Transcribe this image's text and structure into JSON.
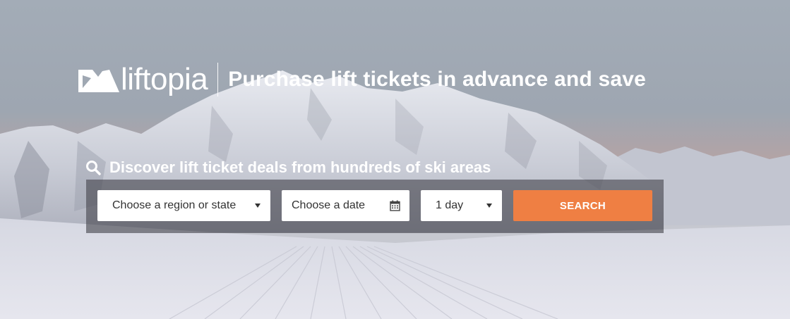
{
  "brand": {
    "logo_text": "liftopia"
  },
  "header": {
    "tagline": "Purchase lift tickets in advance and save"
  },
  "search": {
    "heading": "Discover lift ticket deals from hundreds of ski areas",
    "region_value": "Choose a region or state",
    "date_value": "Choose a date",
    "days_value": "1 day",
    "button_label": "SEARCH"
  },
  "icons": {
    "heading": "search-icon",
    "region": "caret-down-icon",
    "date": "calendar-icon",
    "days": "caret-down-icon"
  },
  "colors": {
    "accent": "#ef7f43",
    "panel": "#46464e",
    "text_light": "#ffffff"
  }
}
